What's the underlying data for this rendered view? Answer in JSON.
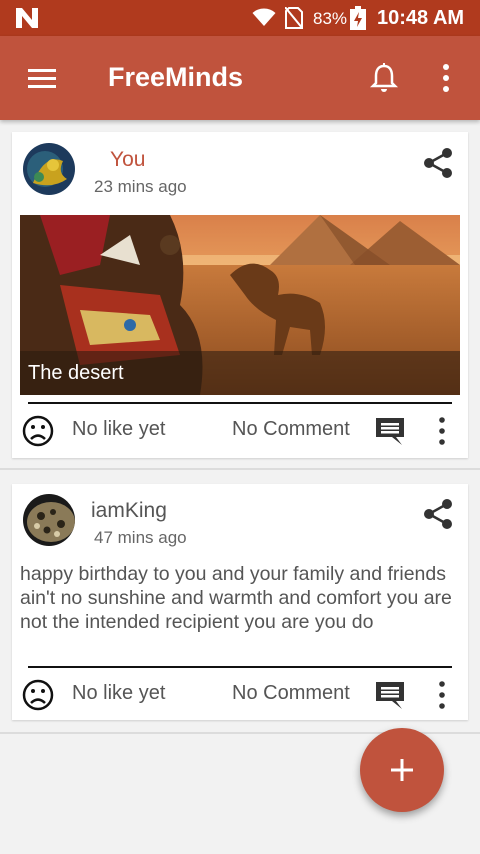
{
  "status_bar": {
    "battery_percent": "83%",
    "time": "10:48 AM",
    "icons": [
      "n-logo-icon",
      "wifi-icon",
      "no-sim-icon",
      "battery-charging-icon"
    ]
  },
  "app_bar": {
    "title": "FreeMinds",
    "icons": [
      "menu-icon",
      "notification-bell-icon",
      "more-vert-icon"
    ]
  },
  "colors": {
    "primary": "#c0533d",
    "status_bar": "#b03a1e",
    "author_highlight": "#c0533d"
  },
  "posts": [
    {
      "author": "You",
      "time_ago": "23 mins ago",
      "image_caption": "The desert",
      "like_text": "No like yet",
      "comment_text": "No Comment"
    },
    {
      "author": "iamKing",
      "time_ago": "47 mins ago",
      "body": "happy birthday to you and your family and friends ain't no sunshine and warmth and comfort you are not the intended recipient you are you do",
      "like_text": "No like yet",
      "comment_text": "No Comment"
    }
  ],
  "fab": {
    "icon": "add-icon"
  }
}
